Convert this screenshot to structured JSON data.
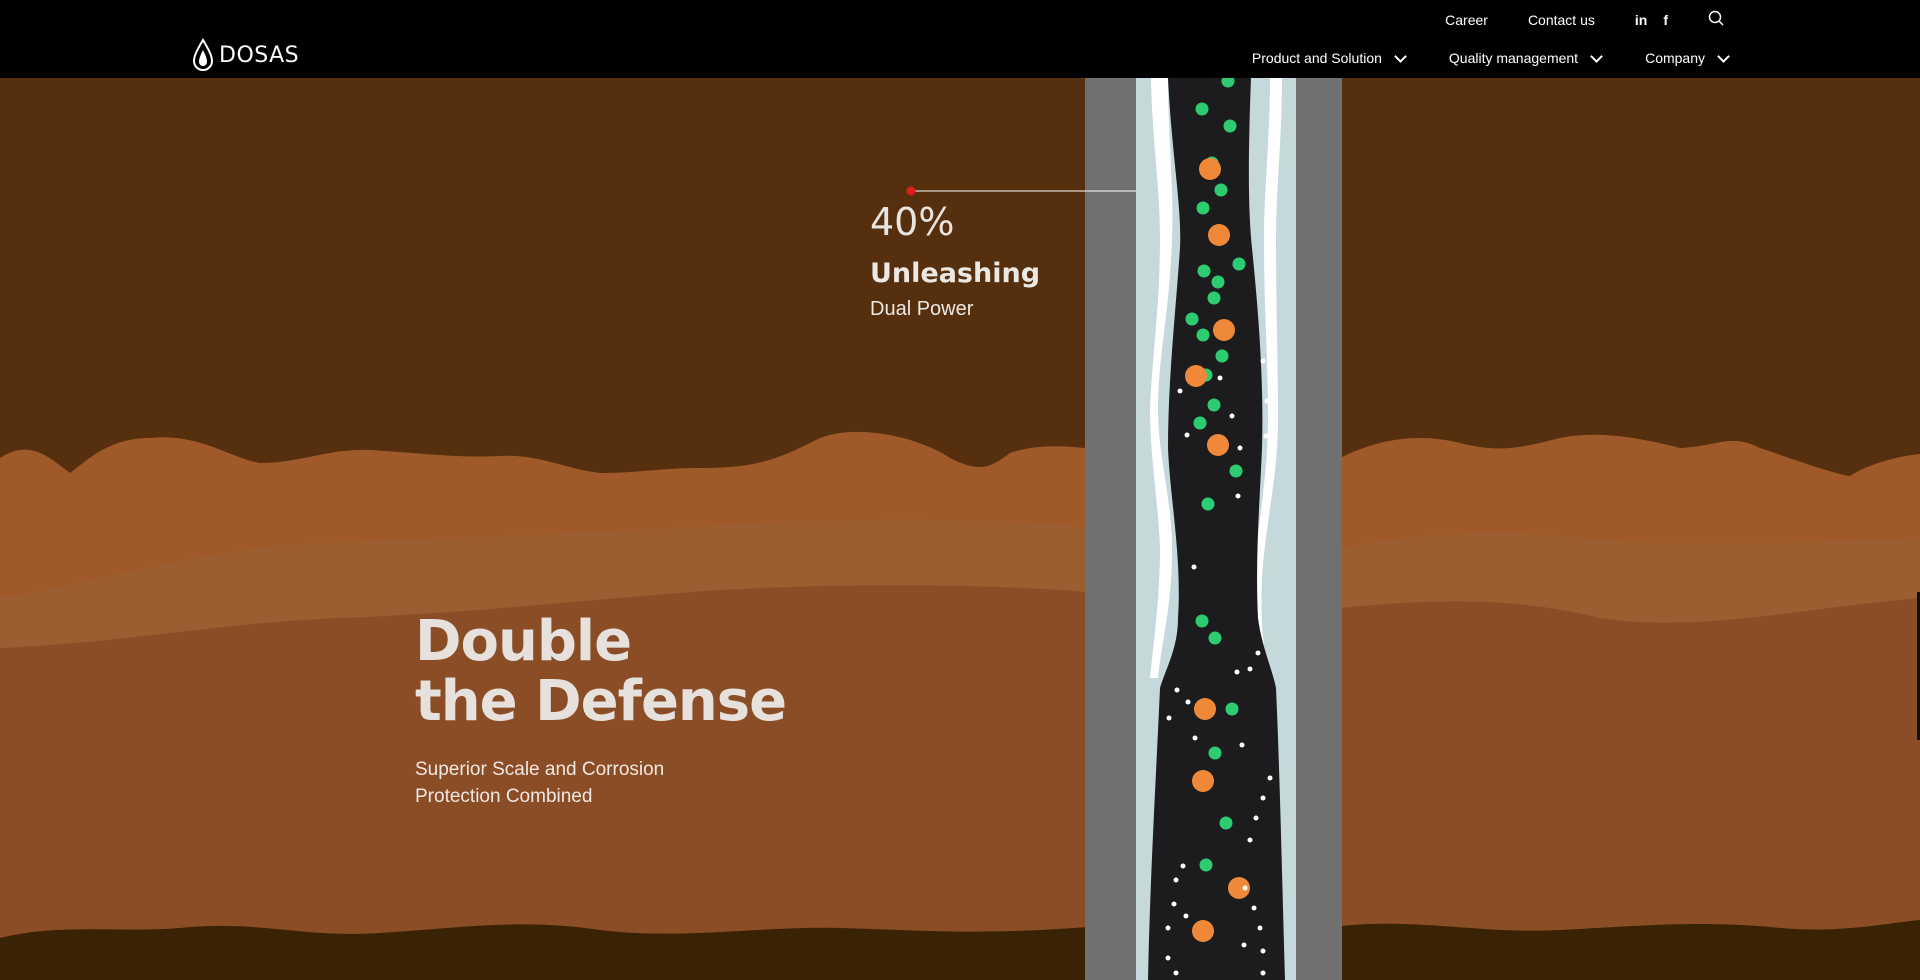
{
  "header": {
    "logo_text": "DOSAS",
    "top_links": [
      "Career",
      "Contact us"
    ],
    "social": {
      "linkedin": "in",
      "facebook": "f"
    },
    "nav": [
      "Product and Solution",
      "Quality management",
      "Company"
    ]
  },
  "hero": {
    "title_line1": "Double",
    "title_line2": "the Defense",
    "subtitle": "Superior Scale and Corrosion Protection Combined"
  },
  "stat": {
    "value": "40%",
    "title": "Unleashing",
    "description": "Dual Power"
  },
  "colors": {
    "sky": "#56300e",
    "layer_orange": "#a05a2a",
    "layer_light": "#9c5e30",
    "layer_mid": "#8a4d25",
    "ground": "#3a2205",
    "casing": "#707070",
    "annulus": "#c5d9dd",
    "well_core": "#1c1c1e",
    "green_particle": "#2ecc71",
    "orange_particle": "#f0883a",
    "callout_dot": "#e01e1e"
  }
}
